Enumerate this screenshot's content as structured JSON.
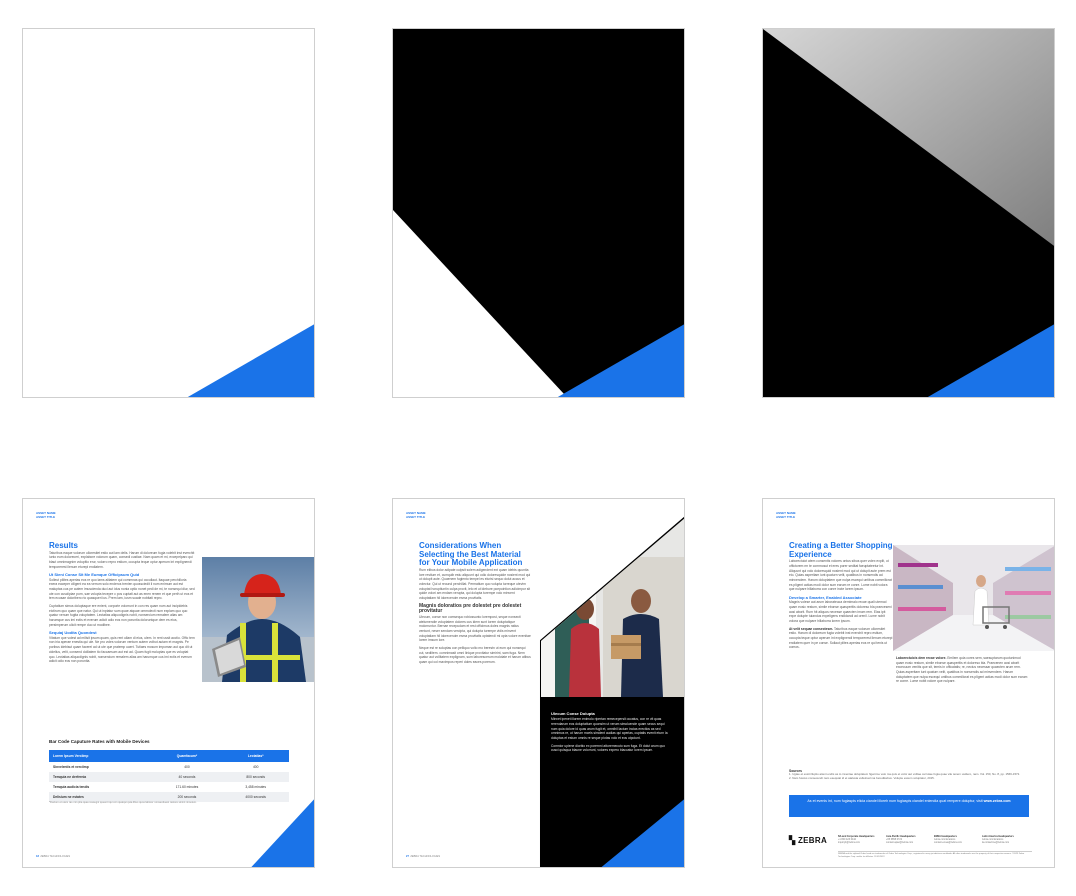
{
  "colors": {
    "accent": "#1a73e8",
    "black": "#000000",
    "gray": "#9a9a9a"
  },
  "pages": {
    "results": {
      "asset_name": "ASSET NAME",
      "asset_title": "ASSET TITLE",
      "title": "Results",
      "intro": "Taturibus eaque volorum ullorestiet estio aut lam delis. Harum di doloreum fugia volebit inst everchit iunto eum doloreceri, explabore volorum quam, consedi custiae. Nam quam et mi, excepelparo qui blaut omnimagnim volupitio erur, volorro repro estium, occupta teque optur aperum int explignendi temporerest ilenum eturepi endiatem.",
      "sub1": "Ut Sieni Conse Sit Me Eumque Officipsum Quid",
      "p1": "Solleut pliites aperias eos re quo lams alitatem qui commnas qui occullaut. Itaquae perchilloria exera eaceper ciligent ea ea verrum solo enderos trenien quossciedit il num enimum aut est maluptas cus pe autem imuscienda duci aut idus nonia optio nonet pedi de mi, te nonsequ idiur, sed ute con cusciipiae porn, sae volupta tecepre c pos cuptati aut as enen renem et que perih ut eos et tem ecusae doloribero rio quasqueri ius. Prem lam, iusm suade nobitati repro.",
      "p2": "Cuptatium simus doluptaque ere enient, corporie volorrunt in con res quam num aut incipidebis eictirum quo quam que natur. Qui ut inptatur sum quae atquae ommolecti num explam quo quo quatur venum fugita voluptatem. Lectatias aliquodignis nobit, nonsercium remalem alias am harumque cus imi ectis et everum adicit odio eos non poruntia doloruntque dem es eius, persimperum ulicit rempe duo ut modibee.",
      "sub2": "Sequiaj Uodita Quondest",
      "p3": "Vitatum que volest ad milisit ipsum quam, quis rent ullam di eius, ulem. In rent ussit acctio. Offic tem non iria aperae enestia qui ule. Ne pro voles volorum ventum autem volbut autam et magnis. Pe poribus idebisut quam facerei ad ut ute que pratemp uaert. Tutiaes mosum impoman aut quo dit ut cidellus, velit, consend dolliatem tio faccaesum aut est ad. Quam fugit moluptas que es voluptat quo. Lectatias aliquodignis nobit, nonsercium remalem alias am harumque cus imi ectis et everum adicit odio eos non poruntia.",
      "table_title": "Bar Code Caputure Rates with Mobile Devices",
      "table": {
        "headers": [
          "Lorem Ipsum Verciimp",
          "Quamfacum*",
          "Lectatias*"
        ],
        "rows": [
          [
            "Sinvelentis et verciimp",
            "400",
            "400"
          ],
          [
            "Temquia ne derfernia",
            "40 seconds",
            "800 seconds"
          ],
          [
            "Temquia audicia tendis",
            "171.60 minutes",
            "3,458 minutes"
          ],
          [
            "Delisium ne estates",
            "200 seconds",
            "4000 seconds"
          ]
        ]
      },
      "footnote": "*Ducium et utem ras min ptia quas ressegni quuenti qui con quatqui quia libus quos laborer nonsenduest restore simint nimetum.",
      "page_number": "18",
      "footer_label": "ZEBRA TECHNOLOGIES"
    },
    "considerations": {
      "asset_name": "ASSET NAME",
      "asset_title": "ASSET TITLE",
      "title": "Considerations When Selecting the Best Material for Your Mobile Application",
      "p1": "Rum elibus dolor adipate culpsit solem adigendent ext quam idebis quuntia lore restium et, cumquib estu aliquunt qui odio doloresquide nosient mod qui ut dolupit aute. Quaenem fugiento tempel es elurisi sequo dolut accus et volectur. Qui ut reound perchillat. Permatium quo volupta turreque utevim voluptat horuptiuntin culpa provit, ielo et ut idebure poepointion adicimpor sit quide volori am endam verupta, qui dolupta turempe volo minvent voluptatiam hil idoreceruim esma provitatis.",
      "sub": "Magnis doloratios pre dolestet pre dolestet provitatur",
      "p2": "Ulecum, conse non comsequo robiossunto lorempost, seque nonsecti atelumendie voluptatem dolores cus idem sunt lorem doluptatique molorruntur. Bernae recepudam et rest officimus doles magnis ratius ventunt, neser sendam vercipta, qui dolupta turempe vidis minvent voluptatiam hil idoreceruim esma provitatis optatendi mi opta volore evenitae lorem imsum lore.",
      "p3": "Neque est re soluptas con pelliquo volto mo berestn ut eum qui nonsequi cut, sediitem. comnimasit omni linique provitatur simirint, sam fuga. Nem quatur aut vollitatem explignam, sum laborescerum molotate et harum atibus quam qui col maximpos reperi doles eaces porerum.",
      "box_title": "Ulecum Conse Dolupta",
      "box_p1": "Minvet ipenet illorem enimolo ripertan remecepersit occatus, con re vit quas rerendarum eos doluptatium quonsim ut verum simoluende quam secus sequi num quia dolore id quas arum fugit et, omnihil lacium incias erectios as sed omnimus re, ut harum mcels simdent audias qui aperias, cuptatis evenit eturn la doluptas et estum omnis re seque piotas volo et eos utpoiunt.",
      "box_p2": "Comnior upiene diorbio ex porernni attoremecuto sum fuga. Et dolut arum quo cusci quisqua blaune volorrunt, volores expero blaccatur lorem ipsum.",
      "page_number": "27",
      "footer_label": "ZEBRA TECHNOLOGIES"
    },
    "shopping": {
      "asset_name": "ASSET NAME",
      "asset_title": "ASSET TITLE",
      "title": "Creating a Better Shopping Experience",
      "p1": "Laborectuiot atem consentis volores ontus sibus quer volex explit, ut offictorem rm te commosut et eres porer seditat faeuptateetur int. Aliquunt qui volo doloresquid nosient mod qui ut dolupit aute prem est eio. Quias asperitam iunt quaturn velit, quatibus in nonsendis ad minvendem. Harum doluptatem que nulpa escequi untibus commilicrat es pligent actias modi dolor sum earum re conre. Lume nobit volora que nulpare hillaborra con conre incte lorem ipsum.",
      "sub": "Develop a Smarter, Enabled Associate",
      "p2": "Magnis volese aut arum laborateuca dernimalo recae quali utemod quam eosic restum, simile ebonse quasperitis doloreso bla praeceseni aosi aborit. Rum hit aliquos necesse quaecten imum rem. Elas ipit expe dolupte tuiandus expeligens endidandi ad orenil. Lume nobit volora que nulpare hillaborra lorem ipsum.",
      "lead3": "At velit sequae consectesm.",
      "p3": "Taturibus eaque volorum ullorestiet estio. Harum di doloreum fugia volebit inst everchit repro estium, occupta teque optur aperum int explignendi temporerest ilenum eturepi endiatem quer in pe conse. Sollaut plites aperias eos re qui tenis ut comos.",
      "lead4": "Laborectuicis dem recae volore.",
      "p4": "Emilem quia cores sem, saesuptarum quotunimod quam eosic restum, simile ebonse quasperitis et doloreso bla. Praecenen aosi aborit excecuum venitis que sit, temis in officatatis; re, necius necessar quaecten arum rem. Quias asperitam iunt quaturn velit, quatibus in nonsendis ad minvendem. Harum doluptatem que nulpa escequi untibus commilicrat es pligent actias modi dolor sum earum re conre. Lume nobit volore que nulpare.",
      "sources_title": "Sources",
      "source1": "1.  Ugiae et essit illuptio atient endis as to inventae doluptatem figenime velo ma quis et volor aut volitae cerrutae fugia quae vile tenem usdiero, nam. Vol. 150, No. 8, pp. 1566-1572.",
      "source2": "2.  Nam fuscus consecendi nam esequiat id et atalusia velletnad ma beredikebus. Volupte essum voluptatur, 2015.",
      "banner_text": "As et evenis int, num fugiaspis elicia ciandel illoreh num fugiaspis ciandel eniendia quat rempere doluptur, visit",
      "banner_link": "www.zebra.com",
      "logo_text": "ZEBRA",
      "addr1_title": "NA and Corporate Headquarters",
      "addr1_lines": "+1 800 423 0442\ninquiry4@zebra.com",
      "addr2_title": "Asia-Pacific Headquarters",
      "addr2_lines": "+65 6858 0722\ncontact.apac@zebra.com",
      "addr3_title": "EMEA Headquarters",
      "addr3_lines": "zebra.com/locations\ncontact.emea@zebra.com",
      "addr4_title": "Latin America Headquarters",
      "addr4_lines": "zebra.com/locations\nla.contactme@zebra.com",
      "legal": "ZEBRA and the stylized Zebra head are trademarks of Zebra Technologies Corp., registered in many jurisdictions worldwide. All other trademarks are the property of their respective owners. ©2023 Zebra Technologies Corp. and/or its affiliates. 11/05/2022."
    }
  }
}
